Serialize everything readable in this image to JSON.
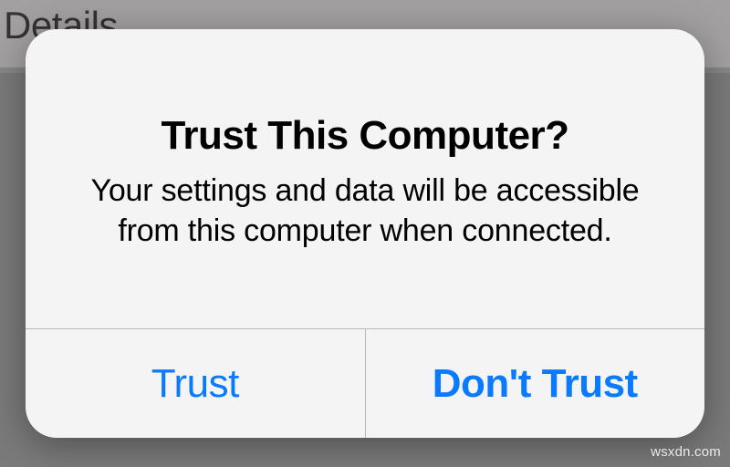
{
  "background": {
    "header_text": "e Details"
  },
  "dialog": {
    "title": "Trust This Computer?",
    "message": "Your settings and data will be accessible from this computer when connected.",
    "buttons": {
      "trust": "Trust",
      "dont_trust": "Don't Trust"
    }
  },
  "watermark": "wsxdn.com"
}
